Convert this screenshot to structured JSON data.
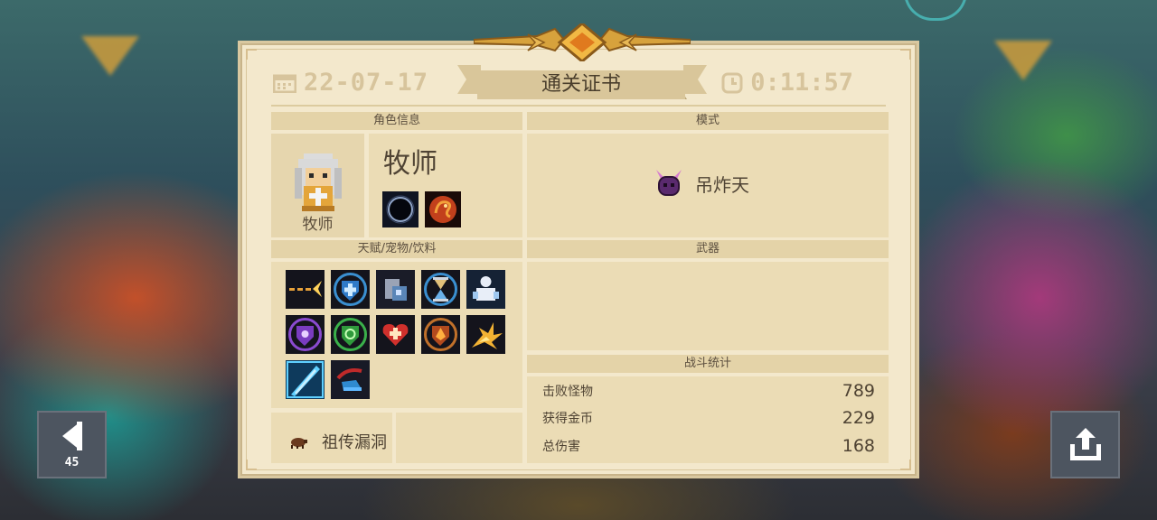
{
  "certificate": {
    "date": "22-07-17",
    "time": "0:11:57",
    "title": "通关证书"
  },
  "sections": {
    "character_info": "角色信息",
    "mode": "模式",
    "talents": "天赋/宠物/饮料",
    "weapons": "武器",
    "battle_stats": "战斗统计"
  },
  "character": {
    "name": "牧师",
    "portrait_label": "牧师",
    "portrait_icon": "priest-portrait-icon",
    "skills": [
      "dark-orb-skill-icon",
      "fire-dragon-skill-icon"
    ]
  },
  "mode": {
    "label": "吊炸天",
    "icon": "horned-demon-icon"
  },
  "talents": [
    "bullet-spark-icon",
    "blue-shield-plus-icon",
    "armor-shield-icon",
    "hourglass-icon",
    "white-knight-icon",
    "purple-shield-icon",
    "green-shield-icon",
    "red-heart-plus-icon",
    "fire-shield-icon",
    "explosion-icon",
    "blue-blade-icon",
    "dash-boot-icon"
  ],
  "flaw": {
    "label": "祖传漏洞",
    "icon": "bug-icon"
  },
  "stats": [
    {
      "label": "击败怪物",
      "value": "789"
    },
    {
      "label": "获得金币",
      "value": "229"
    },
    {
      "label": "总伤害",
      "value": "168"
    }
  ],
  "controls": {
    "back_count": "45",
    "share_icon": "share-icon",
    "back_icon": "back-arrow-icon"
  },
  "colors": {
    "paper": "#f3e8cc",
    "section_bar": "#e4d3a8",
    "panel": "#ebdcb5",
    "gold": "#d7a23c",
    "text": "#4e4232"
  }
}
